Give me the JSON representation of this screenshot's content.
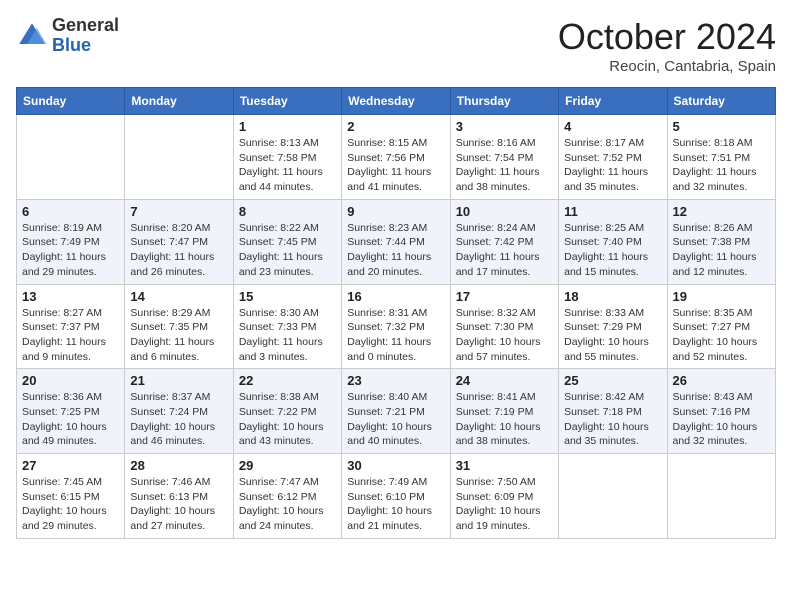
{
  "header": {
    "logo": {
      "general": "General",
      "blue": "Blue"
    },
    "title": "October 2024",
    "location": "Reocin, Cantabria, Spain"
  },
  "weekdays": [
    "Sunday",
    "Monday",
    "Tuesday",
    "Wednesday",
    "Thursday",
    "Friday",
    "Saturday"
  ],
  "weeks": [
    [
      {
        "day": null,
        "sunrise": null,
        "sunset": null,
        "daylight": null
      },
      {
        "day": null,
        "sunrise": null,
        "sunset": null,
        "daylight": null
      },
      {
        "day": "1",
        "sunrise": "Sunrise: 8:13 AM",
        "sunset": "Sunset: 7:58 PM",
        "daylight": "Daylight: 11 hours and 44 minutes."
      },
      {
        "day": "2",
        "sunrise": "Sunrise: 8:15 AM",
        "sunset": "Sunset: 7:56 PM",
        "daylight": "Daylight: 11 hours and 41 minutes."
      },
      {
        "day": "3",
        "sunrise": "Sunrise: 8:16 AM",
        "sunset": "Sunset: 7:54 PM",
        "daylight": "Daylight: 11 hours and 38 minutes."
      },
      {
        "day": "4",
        "sunrise": "Sunrise: 8:17 AM",
        "sunset": "Sunset: 7:52 PM",
        "daylight": "Daylight: 11 hours and 35 minutes."
      },
      {
        "day": "5",
        "sunrise": "Sunrise: 8:18 AM",
        "sunset": "Sunset: 7:51 PM",
        "daylight": "Daylight: 11 hours and 32 minutes."
      }
    ],
    [
      {
        "day": "6",
        "sunrise": "Sunrise: 8:19 AM",
        "sunset": "Sunset: 7:49 PM",
        "daylight": "Daylight: 11 hours and 29 minutes."
      },
      {
        "day": "7",
        "sunrise": "Sunrise: 8:20 AM",
        "sunset": "Sunset: 7:47 PM",
        "daylight": "Daylight: 11 hours and 26 minutes."
      },
      {
        "day": "8",
        "sunrise": "Sunrise: 8:22 AM",
        "sunset": "Sunset: 7:45 PM",
        "daylight": "Daylight: 11 hours and 23 minutes."
      },
      {
        "day": "9",
        "sunrise": "Sunrise: 8:23 AM",
        "sunset": "Sunset: 7:44 PM",
        "daylight": "Daylight: 11 hours and 20 minutes."
      },
      {
        "day": "10",
        "sunrise": "Sunrise: 8:24 AM",
        "sunset": "Sunset: 7:42 PM",
        "daylight": "Daylight: 11 hours and 17 minutes."
      },
      {
        "day": "11",
        "sunrise": "Sunrise: 8:25 AM",
        "sunset": "Sunset: 7:40 PM",
        "daylight": "Daylight: 11 hours and 15 minutes."
      },
      {
        "day": "12",
        "sunrise": "Sunrise: 8:26 AM",
        "sunset": "Sunset: 7:38 PM",
        "daylight": "Daylight: 11 hours and 12 minutes."
      }
    ],
    [
      {
        "day": "13",
        "sunrise": "Sunrise: 8:27 AM",
        "sunset": "Sunset: 7:37 PM",
        "daylight": "Daylight: 11 hours and 9 minutes."
      },
      {
        "day": "14",
        "sunrise": "Sunrise: 8:29 AM",
        "sunset": "Sunset: 7:35 PM",
        "daylight": "Daylight: 11 hours and 6 minutes."
      },
      {
        "day": "15",
        "sunrise": "Sunrise: 8:30 AM",
        "sunset": "Sunset: 7:33 PM",
        "daylight": "Daylight: 11 hours and 3 minutes."
      },
      {
        "day": "16",
        "sunrise": "Sunrise: 8:31 AM",
        "sunset": "Sunset: 7:32 PM",
        "daylight": "Daylight: 11 hours and 0 minutes."
      },
      {
        "day": "17",
        "sunrise": "Sunrise: 8:32 AM",
        "sunset": "Sunset: 7:30 PM",
        "daylight": "Daylight: 10 hours and 57 minutes."
      },
      {
        "day": "18",
        "sunrise": "Sunrise: 8:33 AM",
        "sunset": "Sunset: 7:29 PM",
        "daylight": "Daylight: 10 hours and 55 minutes."
      },
      {
        "day": "19",
        "sunrise": "Sunrise: 8:35 AM",
        "sunset": "Sunset: 7:27 PM",
        "daylight": "Daylight: 10 hours and 52 minutes."
      }
    ],
    [
      {
        "day": "20",
        "sunrise": "Sunrise: 8:36 AM",
        "sunset": "Sunset: 7:25 PM",
        "daylight": "Daylight: 10 hours and 49 minutes."
      },
      {
        "day": "21",
        "sunrise": "Sunrise: 8:37 AM",
        "sunset": "Sunset: 7:24 PM",
        "daylight": "Daylight: 10 hours and 46 minutes."
      },
      {
        "day": "22",
        "sunrise": "Sunrise: 8:38 AM",
        "sunset": "Sunset: 7:22 PM",
        "daylight": "Daylight: 10 hours and 43 minutes."
      },
      {
        "day": "23",
        "sunrise": "Sunrise: 8:40 AM",
        "sunset": "Sunset: 7:21 PM",
        "daylight": "Daylight: 10 hours and 40 minutes."
      },
      {
        "day": "24",
        "sunrise": "Sunrise: 8:41 AM",
        "sunset": "Sunset: 7:19 PM",
        "daylight": "Daylight: 10 hours and 38 minutes."
      },
      {
        "day": "25",
        "sunrise": "Sunrise: 8:42 AM",
        "sunset": "Sunset: 7:18 PM",
        "daylight": "Daylight: 10 hours and 35 minutes."
      },
      {
        "day": "26",
        "sunrise": "Sunrise: 8:43 AM",
        "sunset": "Sunset: 7:16 PM",
        "daylight": "Daylight: 10 hours and 32 minutes."
      }
    ],
    [
      {
        "day": "27",
        "sunrise": "Sunrise: 7:45 AM",
        "sunset": "Sunset: 6:15 PM",
        "daylight": "Daylight: 10 hours and 29 minutes."
      },
      {
        "day": "28",
        "sunrise": "Sunrise: 7:46 AM",
        "sunset": "Sunset: 6:13 PM",
        "daylight": "Daylight: 10 hours and 27 minutes."
      },
      {
        "day": "29",
        "sunrise": "Sunrise: 7:47 AM",
        "sunset": "Sunset: 6:12 PM",
        "daylight": "Daylight: 10 hours and 24 minutes."
      },
      {
        "day": "30",
        "sunrise": "Sunrise: 7:49 AM",
        "sunset": "Sunset: 6:10 PM",
        "daylight": "Daylight: 10 hours and 21 minutes."
      },
      {
        "day": "31",
        "sunrise": "Sunrise: 7:50 AM",
        "sunset": "Sunset: 6:09 PM",
        "daylight": "Daylight: 10 hours and 19 minutes."
      },
      {
        "day": null,
        "sunrise": null,
        "sunset": null,
        "daylight": null
      },
      {
        "day": null,
        "sunrise": null,
        "sunset": null,
        "daylight": null
      }
    ]
  ]
}
